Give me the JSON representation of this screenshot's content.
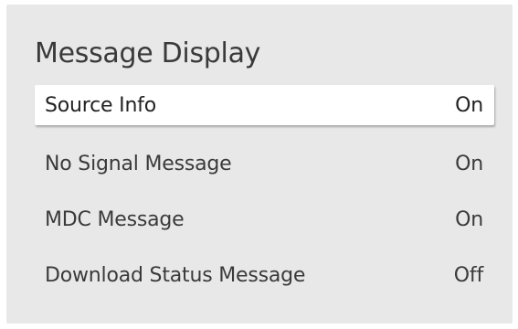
{
  "title": "Message Display",
  "items": [
    {
      "label": "Source Info",
      "value": "On",
      "selected": true
    },
    {
      "label": "No Signal Message",
      "value": "On",
      "selected": false
    },
    {
      "label": "MDC Message",
      "value": "On",
      "selected": false
    },
    {
      "label": "Download Status Message",
      "value": "Off",
      "selected": false
    }
  ],
  "colors": {
    "panel_background": "#e8e8e8",
    "selected_background": "#ffffff",
    "text": "#3a3a3a"
  }
}
